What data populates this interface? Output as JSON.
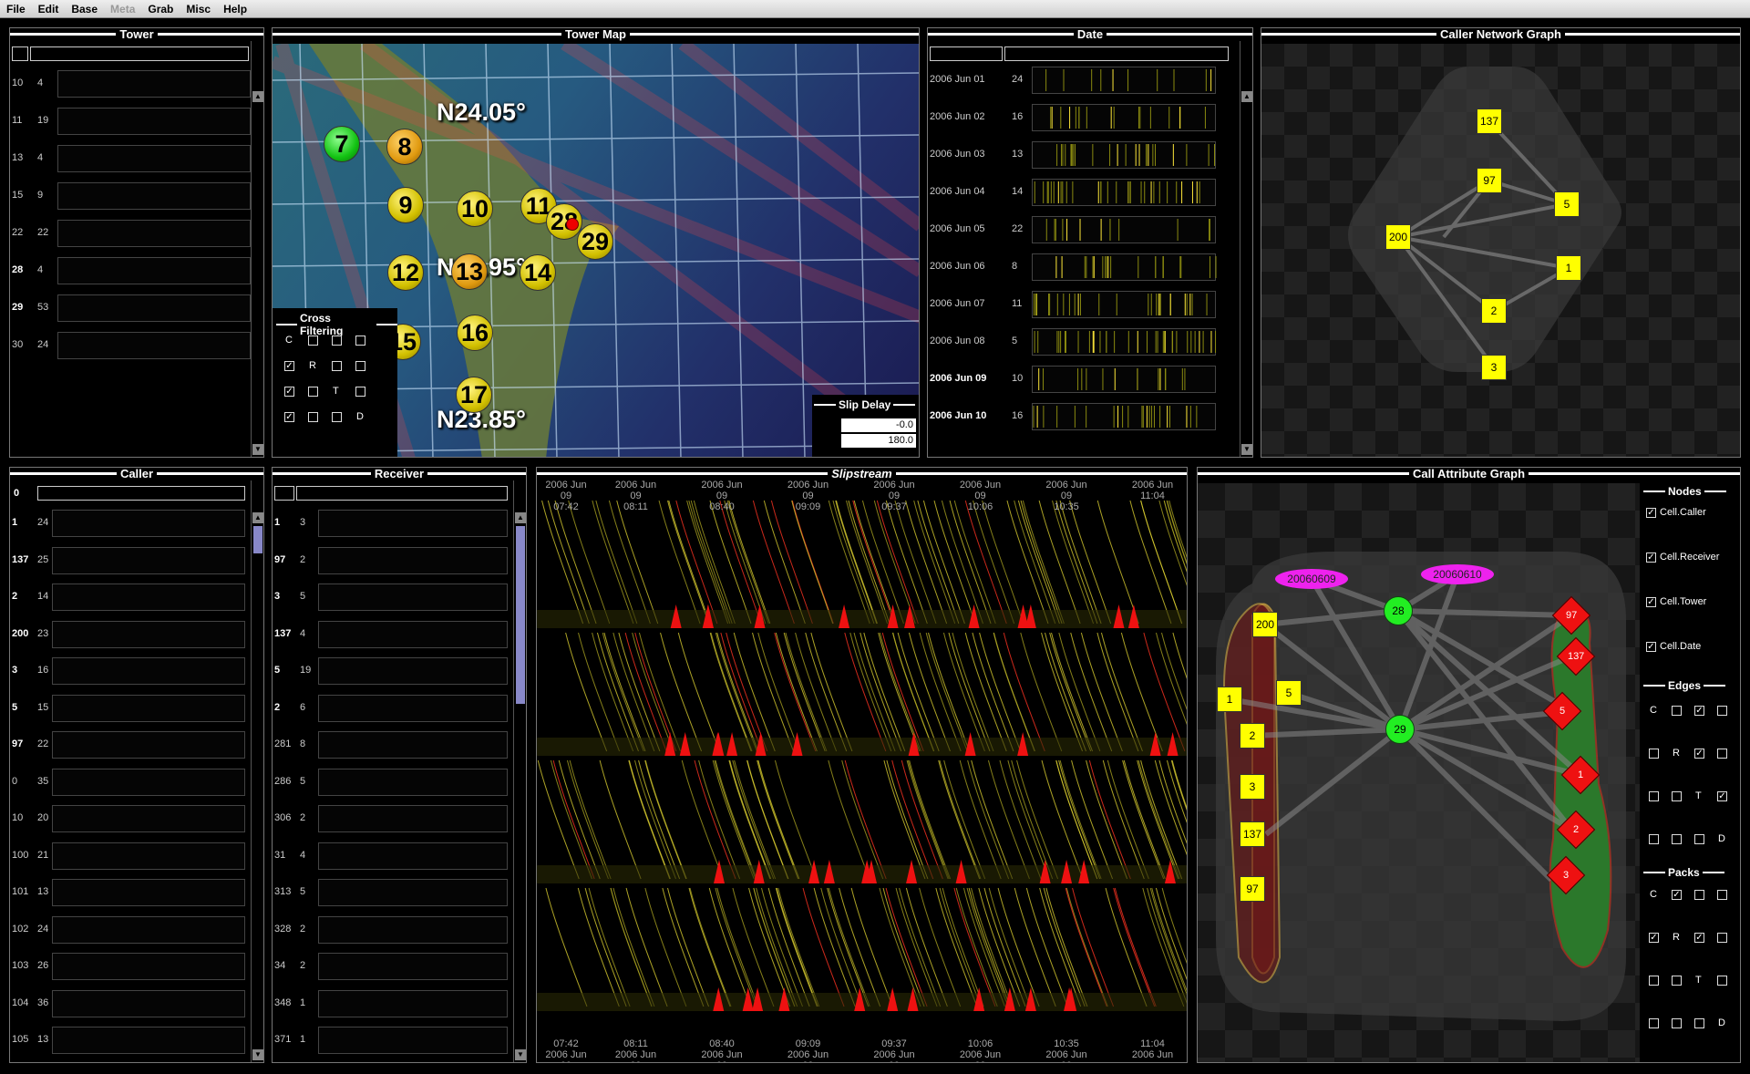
{
  "menu": [
    "File",
    "Edit",
    "Base",
    "Meta",
    "Grab",
    "Misc",
    "Help"
  ],
  "menu_disabled": [
    "Meta"
  ],
  "panels": {
    "tower": "Tower",
    "tower_map": "Tower Map",
    "date": "Date",
    "caller_network": "Caller Network Graph",
    "caller": "Caller",
    "receiver": "Receiver",
    "slipstream": "Slipstream",
    "call_attribute": "Call Attribute Graph"
  },
  "tower_rows": [
    {
      "k": "10",
      "v": "4"
    },
    {
      "k": "11",
      "v": "19"
    },
    {
      "k": "13",
      "v": "4"
    },
    {
      "k": "15",
      "v": "9"
    },
    {
      "k": "22",
      "v": "22"
    },
    {
      "k": "28",
      "v": "4"
    },
    {
      "k": "29",
      "v": "53"
    },
    {
      "k": "30",
      "v": "24"
    }
  ],
  "date_rows": [
    {
      "k": "2006 Jun 01",
      "v": "24"
    },
    {
      "k": "2006 Jun 02",
      "v": "16"
    },
    {
      "k": "2006 Jun 03",
      "v": "13"
    },
    {
      "k": "2006 Jun 04",
      "v": "14"
    },
    {
      "k": "2006 Jun 05",
      "v": "22"
    },
    {
      "k": "2006 Jun 06",
      "v": "8"
    },
    {
      "k": "2006 Jun 07",
      "v": "11"
    },
    {
      "k": "2006 Jun 08",
      "v": "5"
    },
    {
      "k": "2006 Jun 09",
      "v": "10"
    },
    {
      "k": "2006 Jun 10",
      "v": "16"
    }
  ],
  "caller_header": "0",
  "caller_rows": [
    {
      "k": "1",
      "v": "24"
    },
    {
      "k": "137",
      "v": "25"
    },
    {
      "k": "2",
      "v": "14"
    },
    {
      "k": "200",
      "v": "23"
    },
    {
      "k": "3",
      "v": "16"
    },
    {
      "k": "5",
      "v": "15"
    },
    {
      "k": "97",
      "v": "22"
    },
    {
      "k": "0",
      "v": "35"
    },
    {
      "k": "10",
      "v": "20"
    },
    {
      "k": "100",
      "v": "21"
    },
    {
      "k": "101",
      "v": "13"
    },
    {
      "k": "102",
      "v": "24"
    },
    {
      "k": "103",
      "v": "26"
    },
    {
      "k": "104",
      "v": "36"
    },
    {
      "k": "105",
      "v": "13"
    }
  ],
  "receiver_rows": [
    {
      "k": "1",
      "v": "3"
    },
    {
      "k": "97",
      "v": "2"
    },
    {
      "k": "3",
      "v": "5"
    },
    {
      "k": "137",
      "v": "4"
    },
    {
      "k": "5",
      "v": "19"
    },
    {
      "k": "2",
      "v": "6"
    },
    {
      "k": "281",
      "v": "8"
    },
    {
      "k": "286",
      "v": "5"
    },
    {
      "k": "306",
      "v": "2"
    },
    {
      "k": "31",
      "v": "4"
    },
    {
      "k": "313",
      "v": "5"
    },
    {
      "k": "328",
      "v": "2"
    },
    {
      "k": "34",
      "v": "2"
    },
    {
      "k": "348",
      "v": "1"
    },
    {
      "k": "371",
      "v": "1"
    }
  ],
  "map": {
    "lat_labels": [
      "N24.05°",
      "N23.95°",
      "N23.85°"
    ],
    "towers": [
      {
        "id": "7",
        "c": "green"
      },
      {
        "id": "8",
        "c": "orange"
      },
      {
        "id": "9",
        "c": "yellow"
      },
      {
        "id": "10",
        "c": "yellow"
      },
      {
        "id": "11",
        "c": "yellow"
      },
      {
        "id": "28",
        "c": "yellow"
      },
      {
        "id": "29",
        "c": "yellow"
      },
      {
        "id": "12",
        "c": "yellow"
      },
      {
        "id": "13",
        "c": "orange"
      },
      {
        "id": "14",
        "c": "yellow"
      },
      {
        "id": "15",
        "c": "yellow"
      },
      {
        "id": "16",
        "c": "yellow"
      },
      {
        "id": "17",
        "c": "yellow"
      }
    ],
    "cross_filtering": {
      "title": "Cross Filtering",
      "rows": [
        {
          "cells": [
            "C",
            "",
            "",
            ""
          ],
          "checked": [
            false,
            false,
            false,
            false
          ]
        },
        {
          "cells": [
            "",
            "R",
            "",
            ""
          ],
          "checked": [
            true,
            false,
            false,
            false
          ]
        },
        {
          "cells": [
            "",
            "",
            "T",
            ""
          ],
          "checked": [
            true,
            false,
            false,
            false
          ]
        },
        {
          "cells": [
            "",
            "",
            "",
            "D"
          ],
          "checked": [
            true,
            false,
            false,
            false
          ]
        }
      ]
    },
    "slip_delay": {
      "title": "Slip Delay",
      "values": [
        "-0.0",
        "180.0"
      ]
    }
  },
  "caller_network": {
    "nodes": [
      "137",
      "97",
      "5",
      "200",
      "1",
      "2",
      "3"
    ]
  },
  "slipstream": {
    "top_ticks": [
      "2006 Jun 09\n07:42",
      "2006 Jun 09\n08:11",
      "2006 Jun 09\n08:40",
      "2006 Jun 09\n09:09",
      "2006 Jun 09\n09:37",
      "2006 Jun 09\n10:06",
      "2006 Jun 09\n10:35",
      "2006 Jun\n11:04"
    ],
    "bottom_ticks": [
      "07:42\n2006 Jun 09",
      "08:11\n2006 Jun 09",
      "08:40\n2006 Jun 09",
      "09:09\n2006 Jun 09",
      "09:37\n2006 Jun 09",
      "10:06\n2006 Jun 09",
      "10:35\n2006 Jun 09",
      "11:04\n2006 Jun"
    ]
  },
  "call_attr": {
    "dates": [
      "20060609",
      "20060610"
    ],
    "towers": [
      "28",
      "29"
    ],
    "callers": [
      "200",
      "1",
      "5",
      "2",
      "3",
      "137",
      "97"
    ],
    "receivers": [
      "97",
      "137",
      "5",
      "1",
      "2",
      "3"
    ],
    "nodes_title": "Nodes",
    "nodes": [
      {
        "label": "Cell.Caller",
        "checked": true
      },
      {
        "label": "Cell.Receiver",
        "checked": true
      },
      {
        "label": "Cell.Tower",
        "checked": true
      },
      {
        "label": "Cell.Date",
        "checked": true
      }
    ],
    "edges_title": "Edges",
    "edges": [
      {
        "cells": [
          "C",
          "",
          "",
          ""
        ],
        "checked": [
          false,
          false,
          true,
          false
        ]
      },
      {
        "cells": [
          "",
          "R",
          "",
          ""
        ],
        "checked": [
          false,
          false,
          true,
          false
        ]
      },
      {
        "cells": [
          "",
          "",
          "T",
          ""
        ],
        "checked": [
          false,
          false,
          false,
          true
        ]
      },
      {
        "cells": [
          "",
          "",
          "",
          "D"
        ],
        "checked": [
          false,
          false,
          false,
          false
        ]
      }
    ],
    "packs_title": "Packs",
    "packs": [
      {
        "cells": [
          "C",
          "",
          "",
          ""
        ],
        "checked": [
          false,
          true,
          false,
          false
        ]
      },
      {
        "cells": [
          "",
          "R",
          "",
          ""
        ],
        "checked": [
          true,
          false,
          true,
          false
        ]
      },
      {
        "cells": [
          "",
          "",
          "T",
          ""
        ],
        "checked": [
          false,
          false,
          false,
          false
        ]
      },
      {
        "cells": [
          "",
          "",
          "",
          "D"
        ],
        "checked": [
          false,
          false,
          false,
          false
        ]
      }
    ]
  },
  "colors": {
    "yellow": "#ffff00",
    "green": "#22ee22",
    "red": "#ee1111",
    "magenta": "#ee22ee"
  }
}
